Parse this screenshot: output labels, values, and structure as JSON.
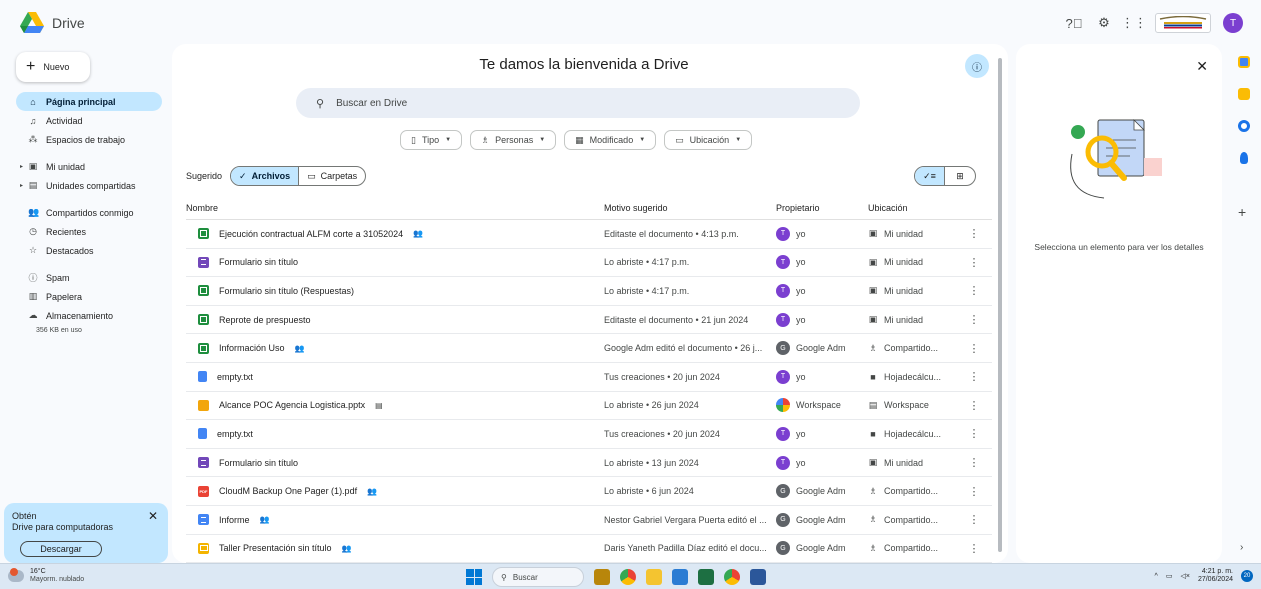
{
  "app": {
    "name": "Drive"
  },
  "sidebar": {
    "new_label": "Nuevo",
    "items": [
      {
        "label": "Página principal",
        "icon": "home-icon"
      },
      {
        "label": "Actividad",
        "icon": "bell-icon"
      },
      {
        "label": "Espacios de trabajo",
        "icon": "workspaces-icon"
      },
      {
        "label": "Mi unidad",
        "icon": "my-drive-icon"
      },
      {
        "label": "Unidades compartidas",
        "icon": "shared-drives-icon"
      },
      {
        "label": "Compartidos conmigo",
        "icon": "people-icon"
      },
      {
        "label": "Recientes",
        "icon": "clock-icon"
      },
      {
        "label": "Destacados",
        "icon": "star-icon"
      },
      {
        "label": "Spam",
        "icon": "spam-icon"
      },
      {
        "label": "Papelera",
        "icon": "trash-icon"
      },
      {
        "label": "Almacenamiento",
        "icon": "cloud-icon"
      }
    ],
    "storage_used": "356 KB en uso",
    "promo": {
      "line1": "Obtén",
      "line2": "Drive para computadoras",
      "button": "Descargar"
    }
  },
  "main": {
    "welcome": "Te damos la bienvenida a Drive",
    "search_placeholder": "Buscar en Drive",
    "filters": [
      "Tipo",
      "Personas",
      "Modificado",
      "Ubicación"
    ],
    "suggested_label": "Sugerido",
    "toggle_files": "Archivos",
    "toggle_folders": "Carpetas",
    "columns": {
      "name": "Nombre",
      "reason": "Motivo sugerido",
      "owner": "Propietario",
      "location": "Ubicación"
    },
    "rows": [
      {
        "name": "Ejecución contractual ALFM corte a 31052024",
        "type": "sheet",
        "shared": true,
        "reason": "Editaste el documento • 4:13 p.m.",
        "owner": "yo",
        "owner_initial": "T",
        "owner_type": "t",
        "location": "Mi unidad",
        "loc_icon": "my-drive-icon"
      },
      {
        "name": "Formulario sin título",
        "type": "form",
        "shared": false,
        "reason": "Lo abriste • 4:17 p.m.",
        "owner": "yo",
        "owner_initial": "T",
        "owner_type": "t",
        "location": "Mi unidad",
        "loc_icon": "my-drive-icon"
      },
      {
        "name": "Formulario sin título (Respuestas)",
        "type": "sheet",
        "shared": false,
        "reason": "Lo abriste • 4:17 p.m.",
        "owner": "yo",
        "owner_initial": "T",
        "owner_type": "t",
        "location": "Mi unidad",
        "loc_icon": "my-drive-icon"
      },
      {
        "name": "Reprote de prespuesto",
        "type": "sheet",
        "shared": false,
        "reason": "Editaste el documento • 21 jun 2024",
        "owner": "yo",
        "owner_initial": "T",
        "owner_type": "t",
        "location": "Mi unidad",
        "loc_icon": "my-drive-icon"
      },
      {
        "name": "Información Uso",
        "type": "sheet",
        "shared": true,
        "reason": "Google Adm editó el documento • 26 j...",
        "owner": "Google Adm",
        "owner_initial": "G",
        "owner_type": "g",
        "location": "Compartido...",
        "loc_icon": "people-icon"
      },
      {
        "name": "empty.txt",
        "type": "txt",
        "shared": false,
        "reason": "Tus creaciones • 20 jun 2024",
        "owner": "yo",
        "owner_initial": "T",
        "owner_type": "t",
        "location": "Hojadecálcu...",
        "loc_icon": "folder-icon"
      },
      {
        "name": "Alcance POC Agencia Logistica.pptx",
        "type": "ppt",
        "shared": false,
        "workspace": true,
        "reason": "Lo abriste • 26 jun 2024",
        "owner": "Workspace",
        "owner_initial": "",
        "owner_type": "w",
        "location": "Workspace",
        "loc_icon": "workspace-icon"
      },
      {
        "name": "empty.txt",
        "type": "txt",
        "shared": false,
        "reason": "Tus creaciones • 20 jun 2024",
        "owner": "yo",
        "owner_initial": "T",
        "owner_type": "t",
        "location": "Hojadecálcu...",
        "loc_icon": "folder-icon"
      },
      {
        "name": "Formulario sin título",
        "type": "form",
        "shared": false,
        "reason": "Lo abriste • 13 jun 2024",
        "owner": "yo",
        "owner_initial": "T",
        "owner_type": "t",
        "location": "Mi unidad",
        "loc_icon": "my-drive-icon"
      },
      {
        "name": "CloudM Backup One Pager (1).pdf",
        "type": "pdf",
        "shared": true,
        "reason": "Lo abriste • 6 jun 2024",
        "owner": "Google Adm",
        "owner_initial": "G",
        "owner_type": "g",
        "location": "Compartido...",
        "loc_icon": "people-icon"
      },
      {
        "name": "Informe",
        "type": "doc",
        "shared": true,
        "reason": "Nestor Gabriel Vergara Puerta editó el ...",
        "owner": "Google Adm",
        "owner_initial": "G",
        "owner_type": "g",
        "location": "Compartido...",
        "loc_icon": "people-icon"
      },
      {
        "name": "Taller Presentación sin título",
        "type": "slides",
        "shared": true,
        "reason": "Daris Yaneth Padilla Díaz editó el docu...",
        "owner": "Google Adm",
        "owner_initial": "G",
        "owner_type": "g",
        "location": "Compartido...",
        "loc_icon": "people-icon"
      }
    ]
  },
  "details": {
    "message": "Selecciona un elemento para ver los detalles"
  },
  "user": {
    "initial": "T"
  },
  "taskbar": {
    "temperature": "16°C",
    "condition": "Mayorm. nublado",
    "search": "Buscar",
    "time": "4:21 p. m.",
    "date": "27/06/2024",
    "notifications": "20"
  }
}
